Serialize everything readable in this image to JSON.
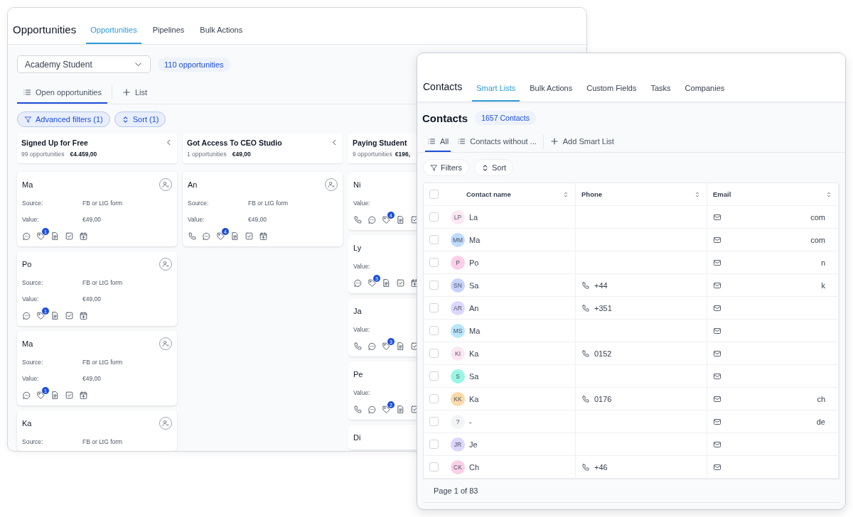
{
  "opportunities_window": {
    "title": "Opportunities",
    "tabs": [
      {
        "label": "Opportunities",
        "selected": true
      },
      {
        "label": "Pipelines",
        "selected": false
      },
      {
        "label": "Bulk Actions",
        "selected": false
      }
    ],
    "pipeline_select": {
      "value": "Academy Student"
    },
    "count_badge": "110 opportunities",
    "views": [
      {
        "kind": "list",
        "label": "Open opportunities",
        "selected": true
      },
      {
        "kind": "add",
        "label": "List",
        "selected": false
      }
    ],
    "filter_buttons": [
      {
        "kind": "filter",
        "label": "Advanced filters (1)"
      },
      {
        "kind": "sort",
        "label": "Sort (1)"
      }
    ],
    "stages": [
      {
        "title": "Signed Up for Free",
        "count": "99 opportunities",
        "total": "€4.459,00",
        "collapse": true,
        "cards": [
          {
            "name": "Ma",
            "assign": true,
            "fields": [
              {
                "label": "Source:",
                "value": "FB or LtG form"
              },
              {
                "label": "Value:",
                "value": "€49,00"
              }
            ],
            "actions": [
              {
                "kind": "chat"
              },
              {
                "kind": "tag",
                "count": "1"
              },
              {
                "kind": "note"
              },
              {
                "kind": "task"
              },
              {
                "kind": "calendar"
              }
            ]
          },
          {
            "name": "Po",
            "assign": true,
            "fields": [
              {
                "label": "Source:",
                "value": "FB or LtG form"
              },
              {
                "label": "Value:",
                "value": "€49,00"
              }
            ],
            "actions": [
              {
                "kind": "chat"
              },
              {
                "kind": "tag",
                "count": "1"
              },
              {
                "kind": "note"
              },
              {
                "kind": "task"
              },
              {
                "kind": "calendar"
              }
            ]
          },
          {
            "name": "Ma",
            "assign": true,
            "fields": [
              {
                "label": "Source:",
                "value": "FB or LtG form"
              },
              {
                "label": "Value:",
                "value": "€49,00"
              }
            ],
            "actions": [
              {
                "kind": "chat"
              },
              {
                "kind": "tag",
                "count": "1"
              },
              {
                "kind": "note"
              },
              {
                "kind": "task"
              },
              {
                "kind": "calendar"
              }
            ]
          },
          {
            "name": "Ka",
            "assign": true,
            "fields": [
              {
                "label": "Source:",
                "value": "FB or LtG form"
              }
            ]
          }
        ]
      },
      {
        "title": "Got Access To CEO Studio",
        "count": "1 opportunities",
        "total": "€49,00",
        "collapse": true,
        "cards": [
          {
            "name": "An",
            "assign": true,
            "fields": [
              {
                "label": "Source:",
                "value": "FB or LtG form"
              },
              {
                "label": "Value:",
                "value": "€49,00"
              }
            ],
            "actions": [
              {
                "kind": "call"
              },
              {
                "kind": "chat"
              },
              {
                "kind": "tag",
                "count": "4"
              },
              {
                "kind": "note"
              },
              {
                "kind": "task"
              },
              {
                "kind": "calendar"
              }
            ]
          }
        ]
      },
      {
        "title": "Paying Student",
        "count": "9 opportunities",
        "total": "€196,",
        "collapse": false,
        "cards": [
          {
            "name": "Ni",
            "assign": false,
            "fields": [
              {
                "label": "Value:"
              }
            ],
            "actions": [
              {
                "kind": "call"
              },
              {
                "kind": "chat"
              },
              {
                "kind": "tag",
                "count": "4"
              },
              {
                "kind": "note"
              },
              {
                "kind": "task"
              }
            ]
          },
          {
            "name": "Ly",
            "assign": false,
            "fields": [
              {
                "label": "Value:"
              }
            ],
            "actions": [
              {
                "kind": "chat"
              },
              {
                "kind": "tag",
                "count": "3"
              },
              {
                "kind": "note"
              },
              {
                "kind": "task"
              },
              {
                "kind": "calendar"
              }
            ]
          },
          {
            "name": "Ja",
            "assign": false,
            "fields": [
              {
                "label": "Value:"
              }
            ],
            "actions": [
              {
                "kind": "call"
              },
              {
                "kind": "chat"
              },
              {
                "kind": "tag",
                "count": "3"
              },
              {
                "kind": "note"
              },
              {
                "kind": "task"
              }
            ]
          },
          {
            "name": "Pe",
            "assign": false,
            "fields": [
              {
                "label": "Value:"
              }
            ],
            "actions": [
              {
                "kind": "call"
              },
              {
                "kind": "chat"
              },
              {
                "kind": "tag",
                "count": "2"
              },
              {
                "kind": "note"
              },
              {
                "kind": "task"
              }
            ]
          },
          {
            "name": "Di",
            "assign": false
          }
        ]
      }
    ]
  },
  "contacts_window": {
    "title": "Contacts",
    "tabs": [
      {
        "label": "Smart Lists",
        "selected": true
      },
      {
        "label": "Bulk Actions",
        "selected": false
      },
      {
        "label": "Custom Fields",
        "selected": false
      },
      {
        "label": "Tasks",
        "selected": false
      },
      {
        "label": "Companies",
        "selected": false
      }
    ],
    "heading": "Contacts",
    "count_badge": "1657 Contacts",
    "lists": [
      {
        "kind": "list",
        "label": "All",
        "selected": true
      },
      {
        "kind": "list",
        "label": "Contacts without ...",
        "selected": false
      },
      {
        "kind": "add",
        "label": "Add Smart List",
        "selected": false
      }
    ],
    "filter_buttons": [
      {
        "kind": "filter",
        "label": "Filters"
      },
      {
        "kind": "sort",
        "label": "Sort"
      }
    ],
    "table": {
      "select_all": {
        "checked": false
      },
      "columns": [
        "Contact name",
        "Phone",
        "Email"
      ],
      "rows": [
        {
          "checked": false,
          "initials": "LP",
          "color": "#fce7f3",
          "name": "La",
          "email": "com"
        },
        {
          "checked": false,
          "initials": "MM",
          "color": "#bfdbfe",
          "name": "Ma",
          "email": "com"
        },
        {
          "checked": false,
          "initials": "P",
          "color": "#fbcfe8",
          "name": "Po",
          "email": "n"
        },
        {
          "checked": false,
          "initials": "SN",
          "color": "#c7d2fe",
          "name": "Sa",
          "phone": "+44",
          "email": "k"
        },
        {
          "checked": false,
          "initials": "AR",
          "color": "#ddd6fe",
          "name": "An",
          "phone": "+351"
        },
        {
          "checked": false,
          "initials": "MS",
          "color": "#bae6fd",
          "name": "Ma"
        },
        {
          "checked": false,
          "initials": "KI",
          "color": "#fce7f3",
          "name": "Ka",
          "phone": "0152"
        },
        {
          "checked": false,
          "initials": "S",
          "color": "#99f6e4",
          "name": "Sa"
        },
        {
          "checked": false,
          "initials": "KK",
          "color": "#fcd9a8",
          "name": "Ka",
          "phone": "0176",
          "email": "ch"
        },
        {
          "checked": false,
          "initials": "?",
          "color": "#f3f4f6",
          "name": "-",
          "email": "de"
        },
        {
          "checked": false,
          "initials": "JR",
          "color": "#ddd6fe",
          "name": "Je"
        },
        {
          "checked": false,
          "initials": "CK",
          "color": "#fbcfe8",
          "name": "Ch",
          "phone": "+46"
        }
      ]
    },
    "pagination": "Page 1 of 83"
  }
}
